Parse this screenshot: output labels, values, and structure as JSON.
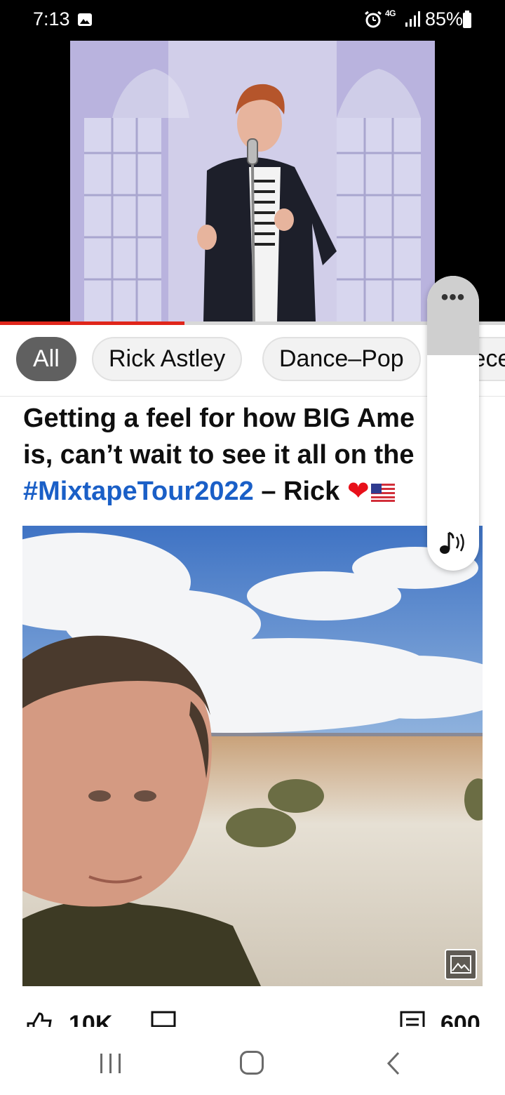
{
  "status_bar": {
    "time": "7:13",
    "network": "4G",
    "battery": "85%"
  },
  "video": {
    "progress": 0.365,
    "accent_color": "#e0261b"
  },
  "chips": [
    {
      "label": "All",
      "active": true
    },
    {
      "label": "Rick Astley",
      "active": false
    },
    {
      "label": "Dance–Pop",
      "active": false
    },
    {
      "label": "Rece",
      "active": false
    }
  ],
  "post": {
    "line1": "Getting a feel for how BIG Ame",
    "line2": "is, can’t wait to see it all on the",
    "hashtag": "#MixtapeTour2022",
    "signoff": " – Rick ",
    "heart": "❤"
  },
  "actions": {
    "likes": "10K",
    "comments": "600"
  },
  "panel": {
    "more_icon": "more-horizontal-icon",
    "audio_icon": "audio-note-icon"
  },
  "nav": {
    "recent_icon": "recent-apps-icon",
    "home_icon": "home-icon",
    "back_icon": "back-icon"
  }
}
